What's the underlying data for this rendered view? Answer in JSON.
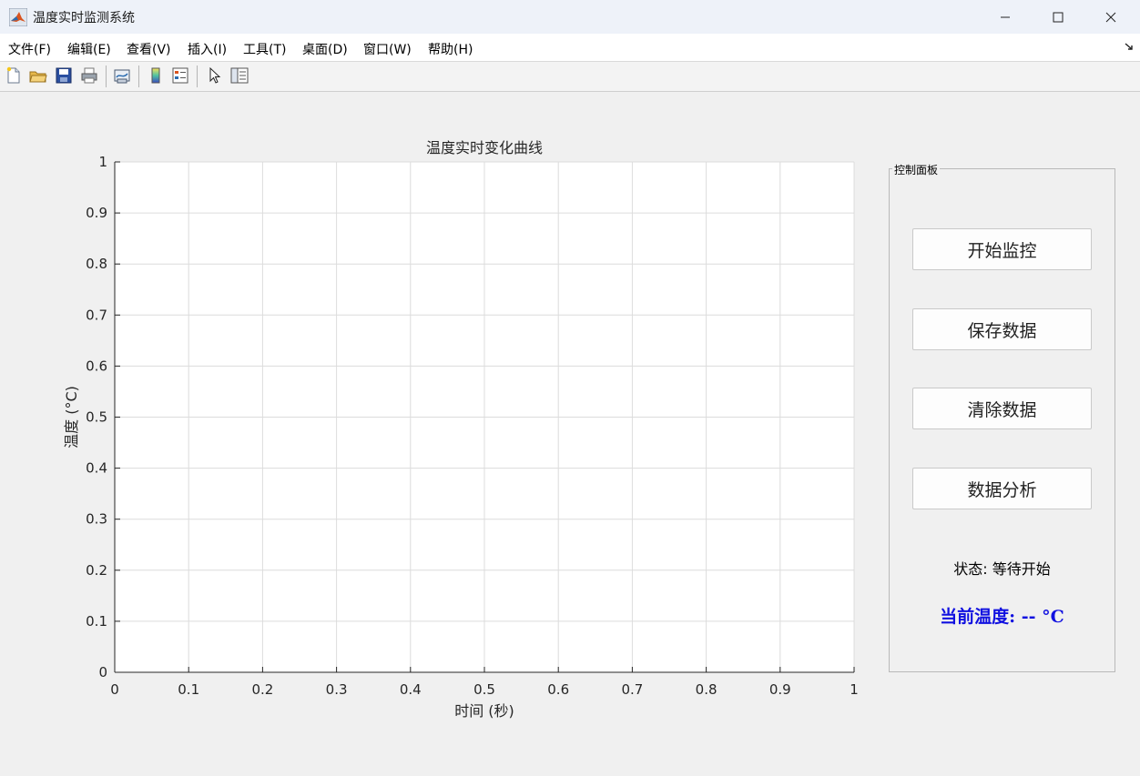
{
  "window": {
    "title": "温度实时监测系统"
  },
  "menu": {
    "items": [
      "文件(F)",
      "编辑(E)",
      "查看(V)",
      "插入(I)",
      "工具(T)",
      "桌面(D)",
      "窗口(W)",
      "帮助(H)"
    ]
  },
  "toolbar": {
    "icons": [
      "new-figure-icon",
      "open-file-icon",
      "save-icon",
      "print-icon",
      "link-plot-icon",
      "colorbar-icon",
      "legend-icon",
      "pointer-icon",
      "property-inspector-icon"
    ]
  },
  "chart_data": {
    "type": "line",
    "title": "温度实时变化曲线",
    "xlabel": "时间 (秒)",
    "ylabel": "温度 (°C)",
    "xlim": [
      0,
      1
    ],
    "ylim": [
      0,
      1
    ],
    "xticks": [
      "0",
      "0.1",
      "0.2",
      "0.3",
      "0.4",
      "0.5",
      "0.6",
      "0.7",
      "0.8",
      "0.9",
      "1"
    ],
    "yticks": [
      "0",
      "0.1",
      "0.2",
      "0.3",
      "0.4",
      "0.5",
      "0.6",
      "0.7",
      "0.8",
      "0.9",
      "1"
    ],
    "grid": true,
    "series": []
  },
  "panel": {
    "title": "控制面板",
    "buttons": [
      "开始监控",
      "保存数据",
      "清除数据",
      "数据分析"
    ],
    "status": "状态: 等待开始",
    "current_temp": "当前温度: -- °C",
    "temp_color": "#1010e0"
  }
}
